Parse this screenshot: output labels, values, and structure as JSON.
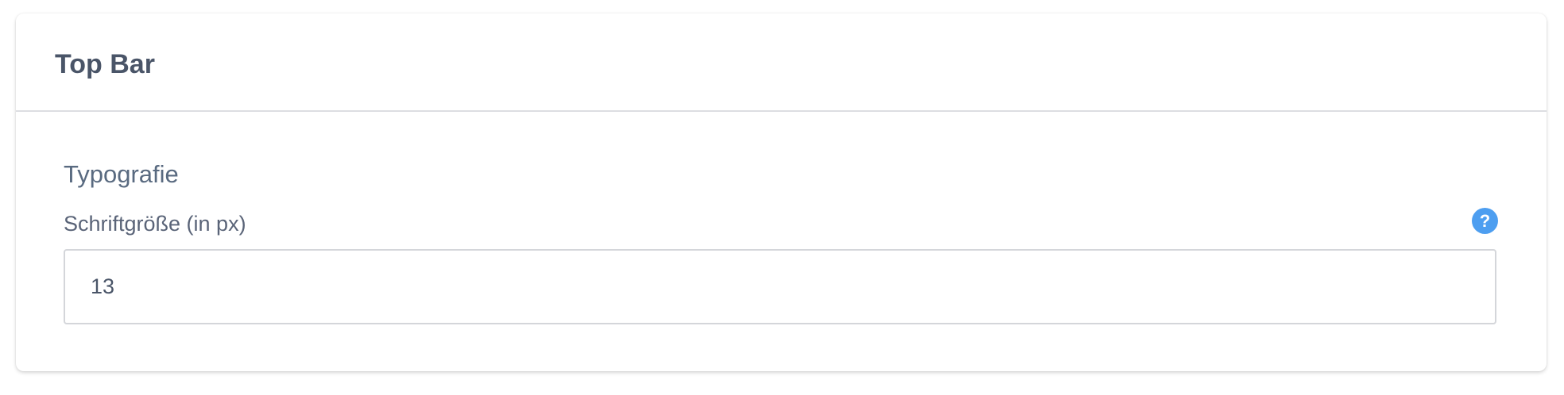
{
  "card": {
    "title": "Top Bar"
  },
  "section": {
    "title": "Typografie"
  },
  "font_size_field": {
    "label": "Schriftgröße (in px)",
    "value": "13",
    "help_icon": "question-mark-icon"
  },
  "colors": {
    "help_icon": "#4d9ef0",
    "title_text": "#4a5568"
  }
}
